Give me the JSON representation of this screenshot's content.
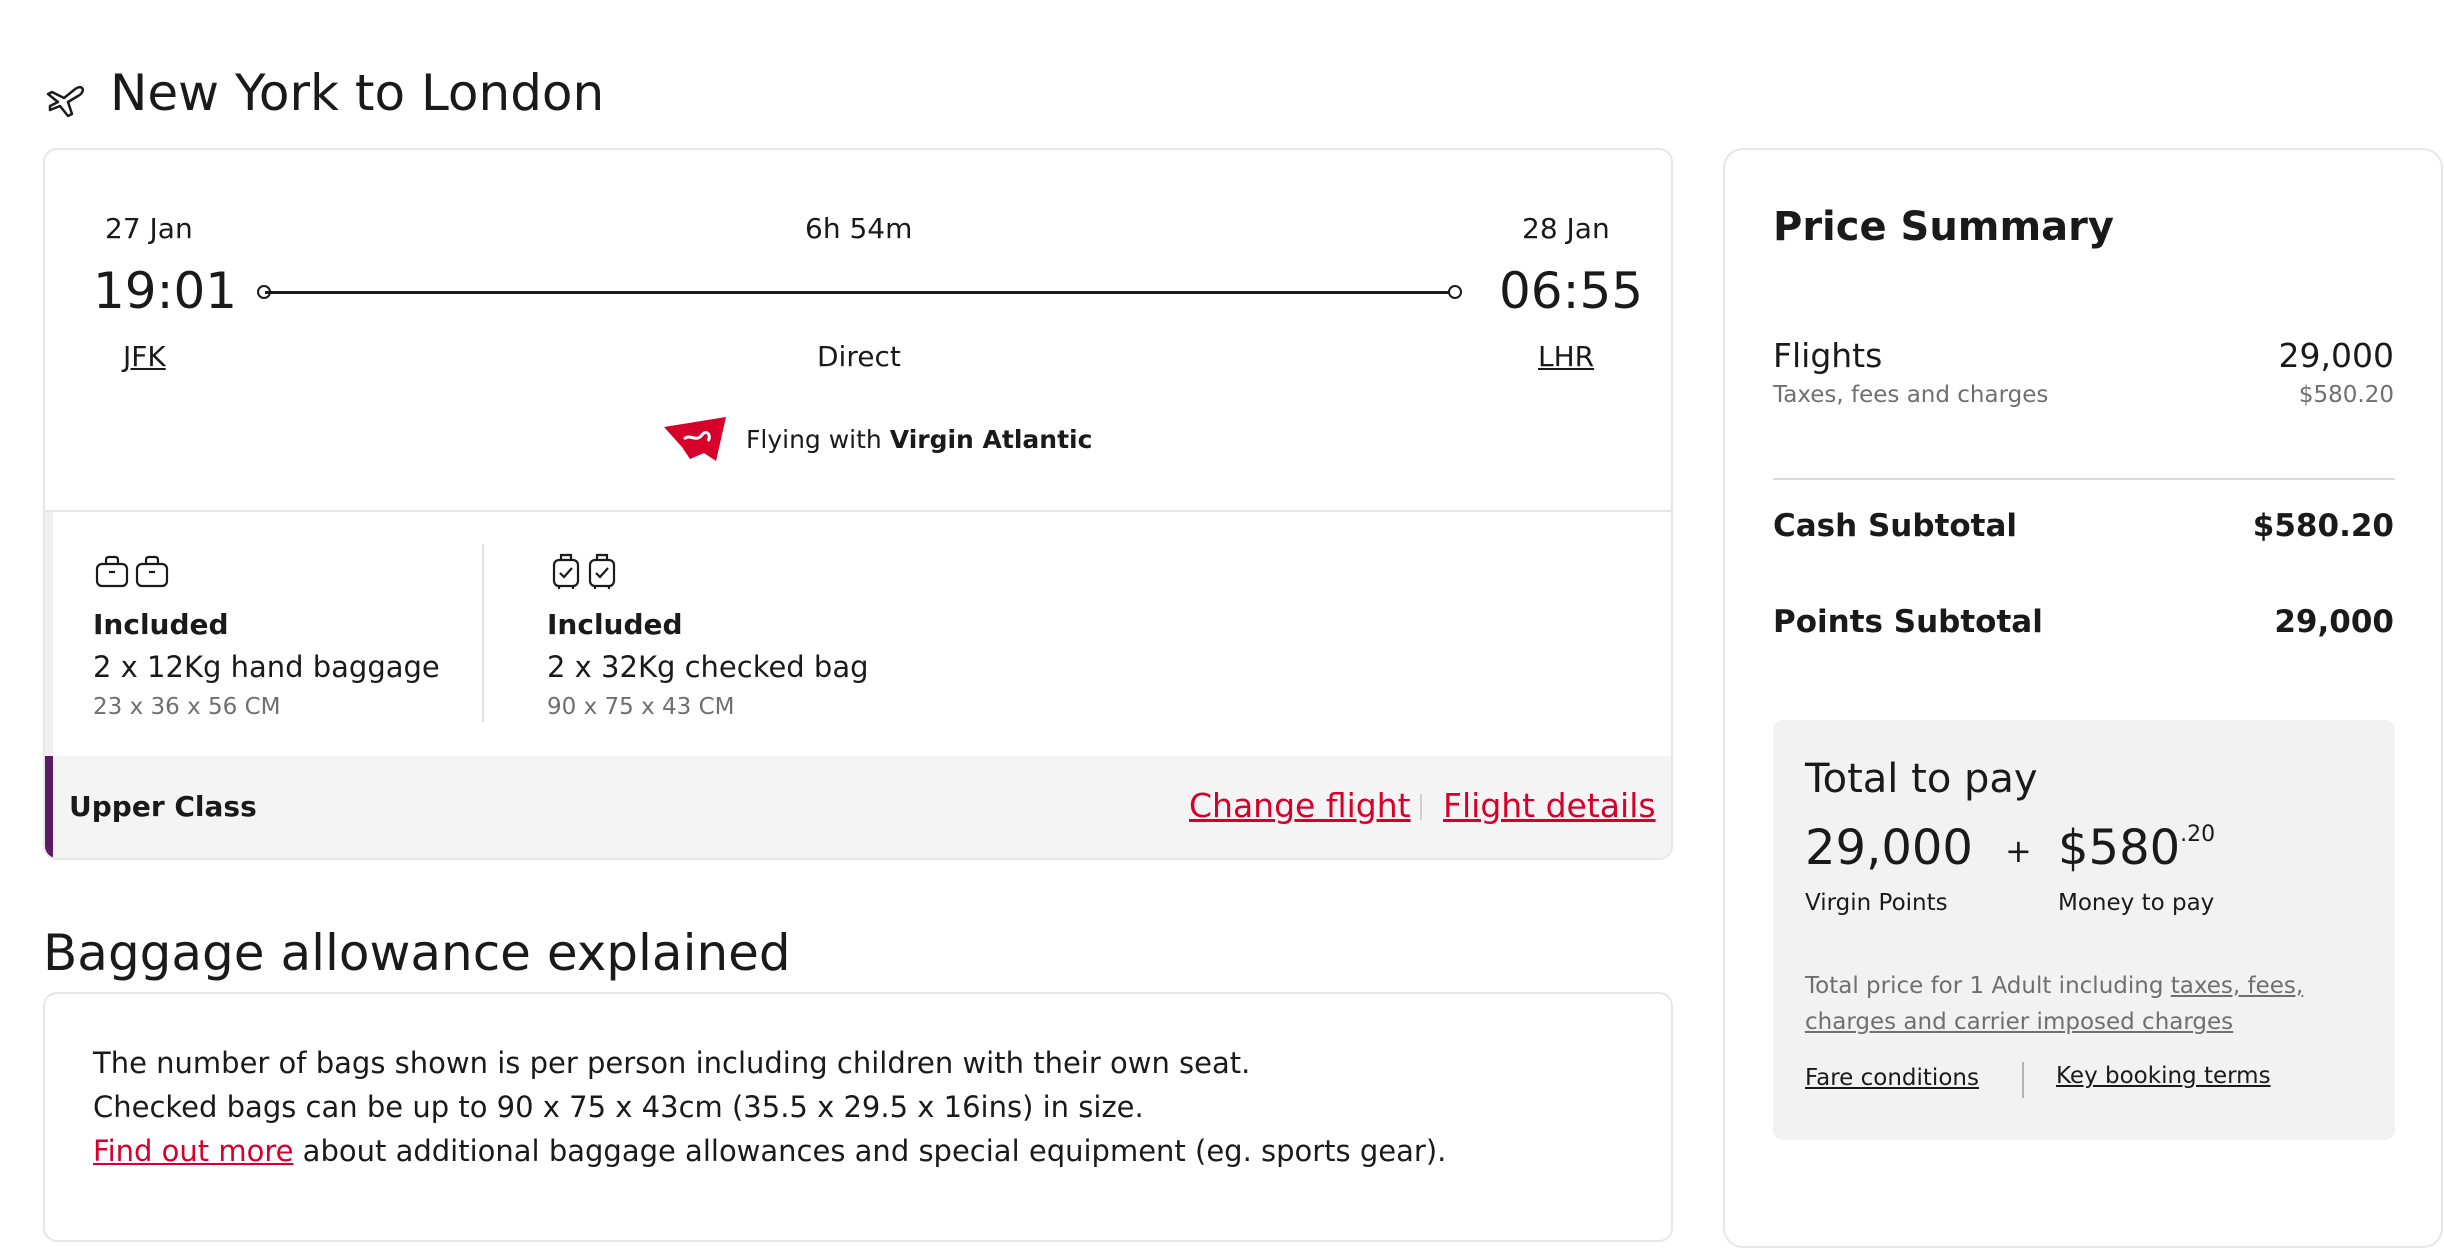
{
  "header": {
    "title": "New York to London",
    "icon": "plane-icon"
  },
  "flight": {
    "depart": {
      "date": "27 Jan",
      "time": "19:01",
      "code": "JFK"
    },
    "arrive": {
      "date": "28 Jan",
      "time": "06:55",
      "code": "LHR"
    },
    "duration": "6h 54m",
    "stops": "Direct",
    "airline_prefix": "Flying with",
    "airline_name": "Virgin Atlantic",
    "airline_logo": "virgin-logo"
  },
  "baggage": {
    "hand": {
      "title": "Included",
      "desc": "2 x 12Kg hand baggage",
      "size": "23 x 36 x 56 CM",
      "icon": "hand-bag-icon"
    },
    "checked": {
      "title": "Included",
      "desc": "2 x 32Kg checked bag",
      "size": "90 x 75 x 43 CM",
      "icon": "checked-bag-icon"
    }
  },
  "cabin": {
    "class": "Upper Class",
    "accent_color": "#5a1a64",
    "change_link": "Change flight",
    "details_link": "Flight details"
  },
  "explained": {
    "title": "Baggage allowance explained",
    "line1": "The number of bags shown is per person including children with their own seat.",
    "line2": "Checked bags can be up to 90 x 75 x 43cm (35.5 x 29.5 x 16ins) in size.",
    "line3_link": "Find out more",
    "line3_rest": " about additional baggage allowances and special equipment (eg. sports gear)."
  },
  "price_summary": {
    "title": "Price Summary",
    "flights_label": "Flights",
    "flights_value": "29,000",
    "taxes_label": "Taxes, fees and charges",
    "taxes_value": "$580.20",
    "cash_label": "Cash Subtotal",
    "cash_value": "$580.20",
    "points_label": "Points Subtotal",
    "points_value": "29,000",
    "total": {
      "title": "Total to pay",
      "points": "29,000",
      "points_caption": "Virgin Points",
      "plus": "+",
      "money_main": "$580",
      "money_cents": ".20",
      "money_caption": "Money to pay",
      "note_prefix": "Total price for 1 Adult including ",
      "note_link_1": "taxes, fees,",
      "note_link_2": "charges and carrier imposed charges",
      "fare_conditions": "Fare conditions",
      "key_terms": "Key booking terms"
    }
  },
  "colors": {
    "brand_red": "#d6002a",
    "text": "#1a1a1a",
    "muted": "#6f6f6f"
  }
}
